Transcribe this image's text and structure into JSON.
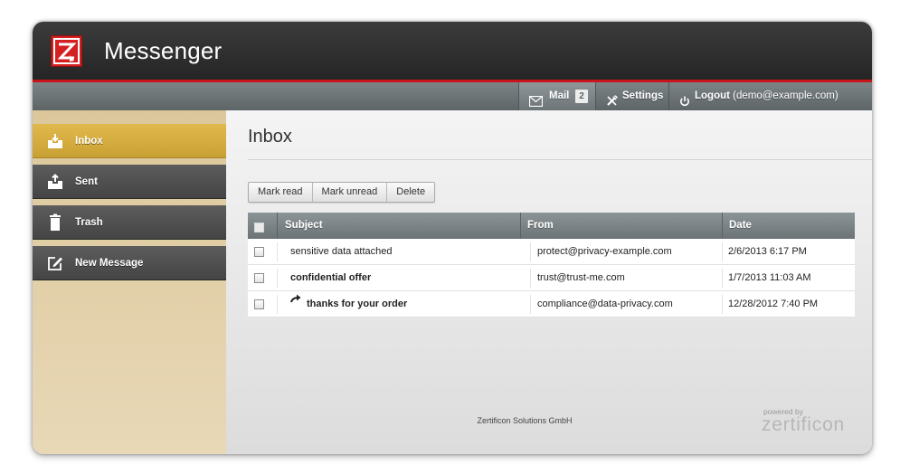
{
  "app": {
    "title": "Messenger",
    "logo_text": "Z"
  },
  "nav": {
    "mail_label": "Mail",
    "mail_count": "2",
    "settings_label": "Settings",
    "logout_label": "Logout",
    "logout_user": "(demo@example.com)"
  },
  "sidebar": {
    "items": [
      {
        "label": "Inbox",
        "icon": "inbox-icon",
        "active": true
      },
      {
        "label": "Sent",
        "icon": "sent-icon",
        "active": false
      },
      {
        "label": "Trash",
        "icon": "trash-icon",
        "active": false
      },
      {
        "label": "New Message",
        "icon": "compose-icon",
        "active": false
      }
    ]
  },
  "main": {
    "page_title": "Inbox",
    "actions": {
      "mark_read": "Mark read",
      "mark_unread": "Mark unread",
      "delete": "Delete"
    },
    "table": {
      "columns": {
        "subject": "Subject",
        "from": "From",
        "date": "Date"
      },
      "rows": [
        {
          "subject": "sensitive data attached",
          "from": "protect@privacy-example.com",
          "date": "2/6/2013 6:17 PM",
          "unread": false,
          "replied": false
        },
        {
          "subject": "confidential offer",
          "from": "trust@trust-me.com",
          "date": "1/7/2013 11:03 AM",
          "unread": true,
          "replied": false
        },
        {
          "subject": "thanks for your order",
          "from": "compliance@data-privacy.com",
          "date": "12/28/2012 7:40 PM",
          "unread": true,
          "replied": true
        }
      ]
    }
  },
  "footer": {
    "company": "Zertificon Solutions GmbH",
    "powered_by": "powered by",
    "brand": "zertificon"
  },
  "colors": {
    "accent_red": "#c8151b",
    "active_gold": "#d6ae40",
    "header_dark": "#2e2e2e",
    "nav_gray": "#6d7578"
  }
}
